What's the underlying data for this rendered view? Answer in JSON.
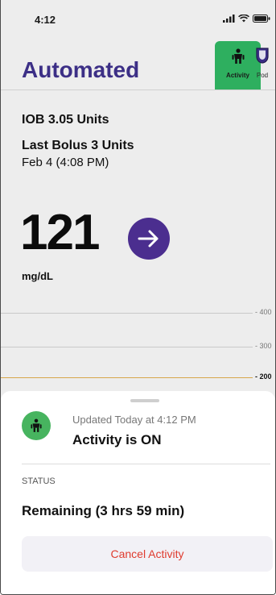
{
  "status_bar": {
    "time": "4:12",
    "icons": [
      "signal-icon",
      "wifi-icon",
      "battery-icon"
    ]
  },
  "header": {
    "title": "Automated",
    "tabs": [
      {
        "label": "Activity",
        "icon": "activity-person-icon",
        "active": true,
        "color": "#2eaf5f"
      },
      {
        "label": "Pod",
        "icon": "pod-icon",
        "active": false
      }
    ]
  },
  "summary": {
    "iob": "IOB 3.05 Units",
    "last_bolus": "Last Bolus 3 Units",
    "last_bolus_date": "Feb 4 (4:08 PM)"
  },
  "glucose": {
    "value": "121",
    "units": "mg/dL",
    "trend_icon": "arrow-right-icon",
    "trend_color": "#4b2e8f"
  },
  "graph": {
    "grid_labels": [
      "- 400",
      "- 300",
      "- 200"
    ]
  },
  "sheet": {
    "icon": "activity-person-icon",
    "updated": "Updated Today at 4:12 PM",
    "headline": "Activity is ON",
    "status_label": "STATUS",
    "remaining": "Remaining (3 hrs 59 min)",
    "cancel_label": "Cancel Activity"
  },
  "colors": {
    "brand": "#3c2f86",
    "activity_green": "#2eaf5f",
    "danger": "#df3b2e"
  }
}
